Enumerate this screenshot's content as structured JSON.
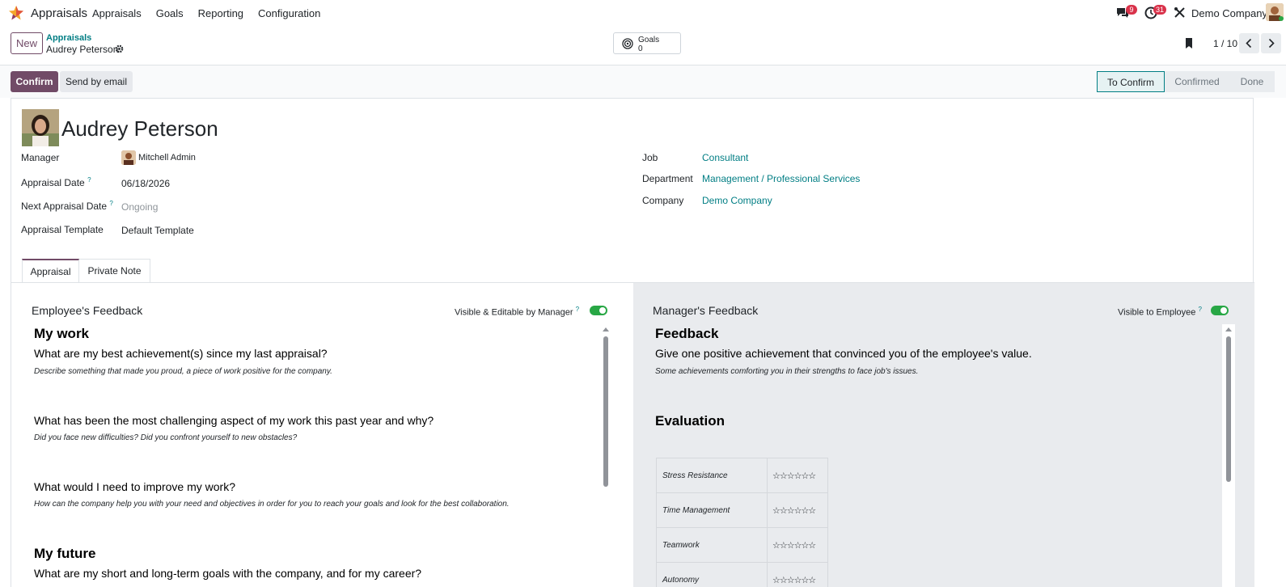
{
  "navbar": {
    "app_name": "Appraisals",
    "menu": [
      "Appraisals",
      "Goals",
      "Reporting",
      "Configuration"
    ],
    "messages_count": "9",
    "activities_count": "31",
    "company": "Demo Company"
  },
  "control": {
    "new_label": "New",
    "breadcrumb_parent": "Appraisals",
    "breadcrumb_current": "Audrey Peterson",
    "goals_label": "Goals",
    "goals_count": "0",
    "pager": "1 / 10"
  },
  "status": {
    "confirm_label": "Confirm",
    "send_email_label": "Send by email",
    "stages": [
      "To Confirm",
      "Confirmed",
      "Done"
    ],
    "active_stage": "To Confirm"
  },
  "employee": {
    "name": "Audrey Peterson",
    "fields_left": [
      {
        "label": "Manager",
        "value": "Mitchell Admin",
        "help": ""
      },
      {
        "label": "Appraisal Date",
        "value": "06/18/2026",
        "help": "?"
      },
      {
        "label": "Next Appraisal Date",
        "value": "Ongoing",
        "help": "?"
      },
      {
        "label": "Appraisal Template",
        "value": "Default Template",
        "help": ""
      }
    ],
    "fields_right": [
      {
        "label": "Job",
        "value": "Consultant"
      },
      {
        "label": "Department",
        "value": "Management / Professional Services"
      },
      {
        "label": "Company",
        "value": "Demo Company"
      }
    ]
  },
  "tabs": [
    "Appraisal",
    "Private Note"
  ],
  "employee_feedback": {
    "title": "Employee's Feedback",
    "toggle_label": "Visible & Editable by Manager",
    "toggle_on": true,
    "sections": [
      {
        "heading": "My work"
      },
      {
        "question": "What are my best achievement(s) since my last appraisal?",
        "hint": "Describe something that made you proud, a piece of work positive for the company."
      },
      {
        "question": "What has been the most challenging aspect of my work this past year and why?",
        "hint": "Did you face new difficulties? Did you confront yourself to new obstacles?"
      },
      {
        "question": "What would I need to improve my work?",
        "hint": "How can the company help you with your need and objectives in order for you to reach your goals and look for the best collaboration."
      },
      {
        "heading": "My future"
      },
      {
        "question": "What are my short and long-term goals with the company, and for my career?"
      }
    ]
  },
  "manager_feedback": {
    "title": "Manager's Feedback",
    "toggle_label": "Visible to Employee",
    "toggle_on": true,
    "heading": "Feedback",
    "question": "Give one positive achievement that convinced you of the employee's value.",
    "hint": "Some achievements comforting you in their strengths to face job's issues.",
    "evaluation_heading": "Evaluation",
    "evaluation": [
      {
        "criterion": "Stress Resistance",
        "stars": "☆☆☆☆☆☆"
      },
      {
        "criterion": "Time Management",
        "stars": "☆☆☆☆☆☆"
      },
      {
        "criterion": "Teamwork",
        "stars": "☆☆☆☆☆☆"
      },
      {
        "criterion": "Autonomy",
        "stars": "☆☆☆☆☆☆"
      }
    ]
  },
  "colors": {
    "brand": "#714b67",
    "link": "#017e84",
    "toggle": "#28a745",
    "badge": "#d9324a"
  }
}
